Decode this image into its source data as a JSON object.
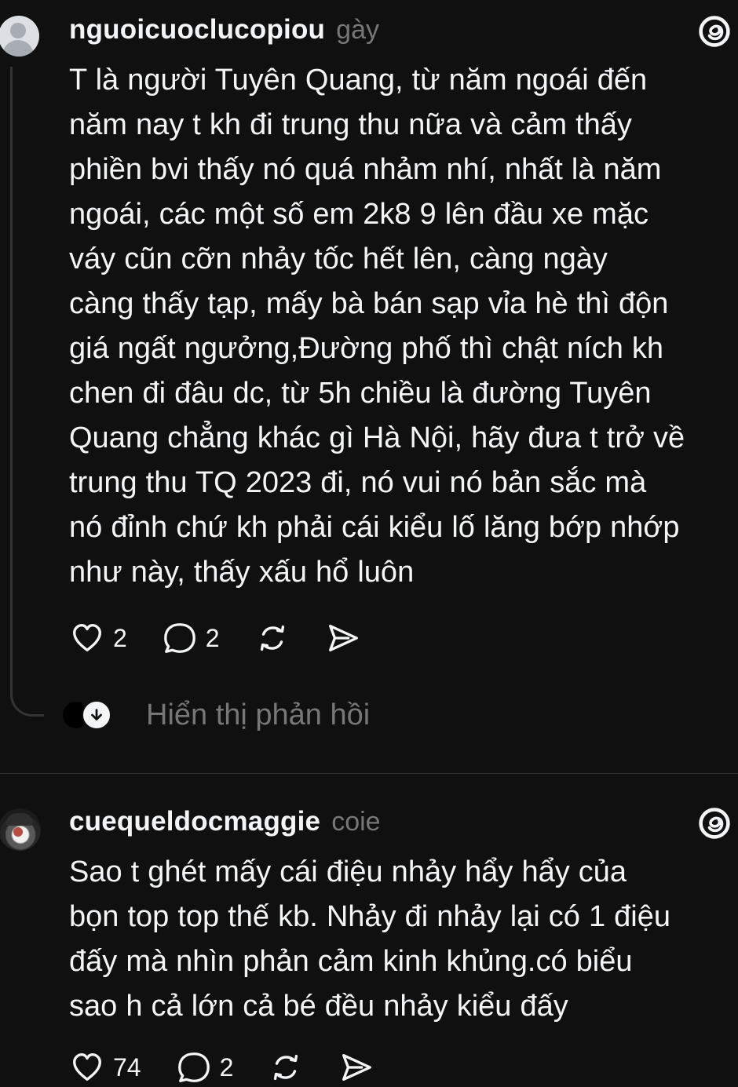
{
  "posts": [
    {
      "username": "nguoicuoclucopiou",
      "time": "gày",
      "body": "T là người Tuyên Quang, từ năm ngoái đến\nnăm nay t kh đi trung thu nữa và cảm thấy\nphiền bvi thấy nó quá nhảm nhí, nhất là năm\nngoái, các một số em 2k8 9 lên đầu xe mặc\nváy cũn cỡn nhảy tốc hết lên, càng ngày\ncàng thấy tạp, mấy bà bán sạp vỉa hè thì độn\ngiá ngất ngưởng,Đường phố thì chật ních kh\nchen đi đâu dc, từ 5h chiều là đường Tuyên\nQuang chẳng khác gì Hà Nội, hãy đưa t trở về\ntrung thu TQ 2023 đi, nó vui nó bản sắc mà\nnó đỉnh chứ kh phải cái kiểu lố lăng bớp nhớp\nnhư này, thấy xấu hổ luôn",
      "like_count": "2",
      "reply_count": "2"
    },
    {
      "username": "cuequeldocmaggie",
      "time": "coie",
      "body": "Sao t ghét mấy cái điệu nhảy hẩy hẩy của\nbọn top top thế kb. Nhảy đi nhảy lại có 1 điệu\nđấy mà nhìn phản cảm kinh khủng.có biểu\nsao h cả lớn cả bé đều nhảy kiểu đấy",
      "like_count": "74",
      "reply_count": "2"
    }
  ],
  "replies_label": "Hiển thị phản hồi",
  "icons": {
    "threads": "threads-logo-icon",
    "like": "heart-icon",
    "reply": "comment-icon",
    "repost": "repost-icon",
    "share": "send-icon",
    "expand": "arrow-down-icon"
  },
  "colors": {
    "background": "#101010",
    "text": "#f3f5f7",
    "muted": "#777777",
    "line": "#343434"
  }
}
